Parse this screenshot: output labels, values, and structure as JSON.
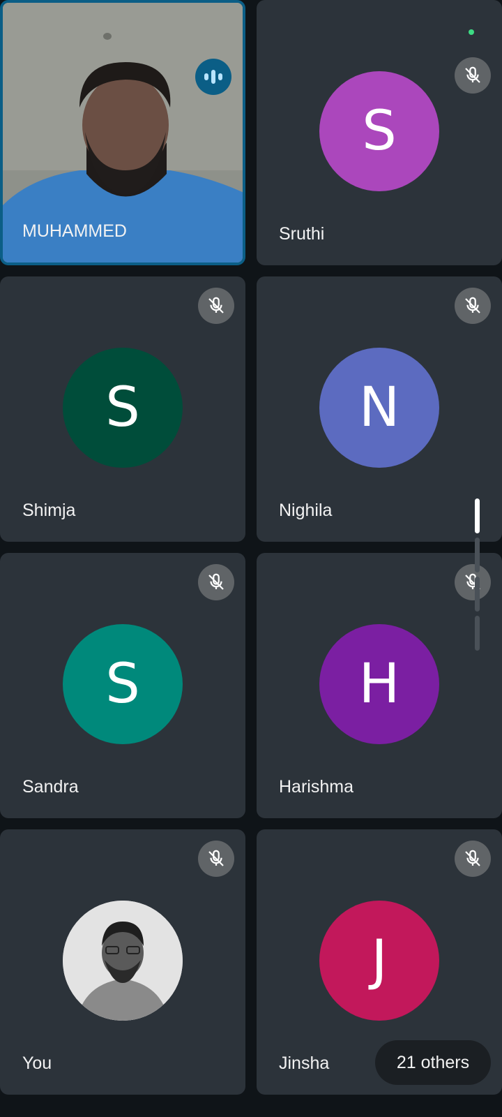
{
  "participants": [
    {
      "name": "MUHAMMED",
      "initial": "",
      "color": "",
      "type": "video",
      "speaking": true
    },
    {
      "name": "Sruthi",
      "initial": "S",
      "color": "#ab47bc",
      "type": "initial",
      "muted": true
    },
    {
      "name": "Shimja",
      "initial": "S",
      "color": "#004d3a",
      "type": "initial",
      "muted": true
    },
    {
      "name": "Nighila",
      "initial": "N",
      "color": "#5c6bc0",
      "type": "initial",
      "muted": true
    },
    {
      "name": "Sandra",
      "initial": "S",
      "color": "#00897b",
      "type": "initial",
      "muted": true
    },
    {
      "name": "Harishma",
      "initial": "H",
      "color": "#7b1fa2",
      "type": "initial",
      "muted": true
    },
    {
      "name": "You",
      "initial": "",
      "color": "",
      "type": "photo",
      "muted": true
    },
    {
      "name": "Jinsha",
      "initial": "J",
      "color": "#c2185b",
      "type": "initial",
      "muted": true
    }
  ],
  "others_label": "21 others",
  "icons": {
    "mute": "mic-off-icon",
    "speaking": "audio-wave-icon"
  },
  "colors": {
    "background": "#0f1418",
    "tile": "#2c333a",
    "speaking_border": "#0b5e86"
  }
}
